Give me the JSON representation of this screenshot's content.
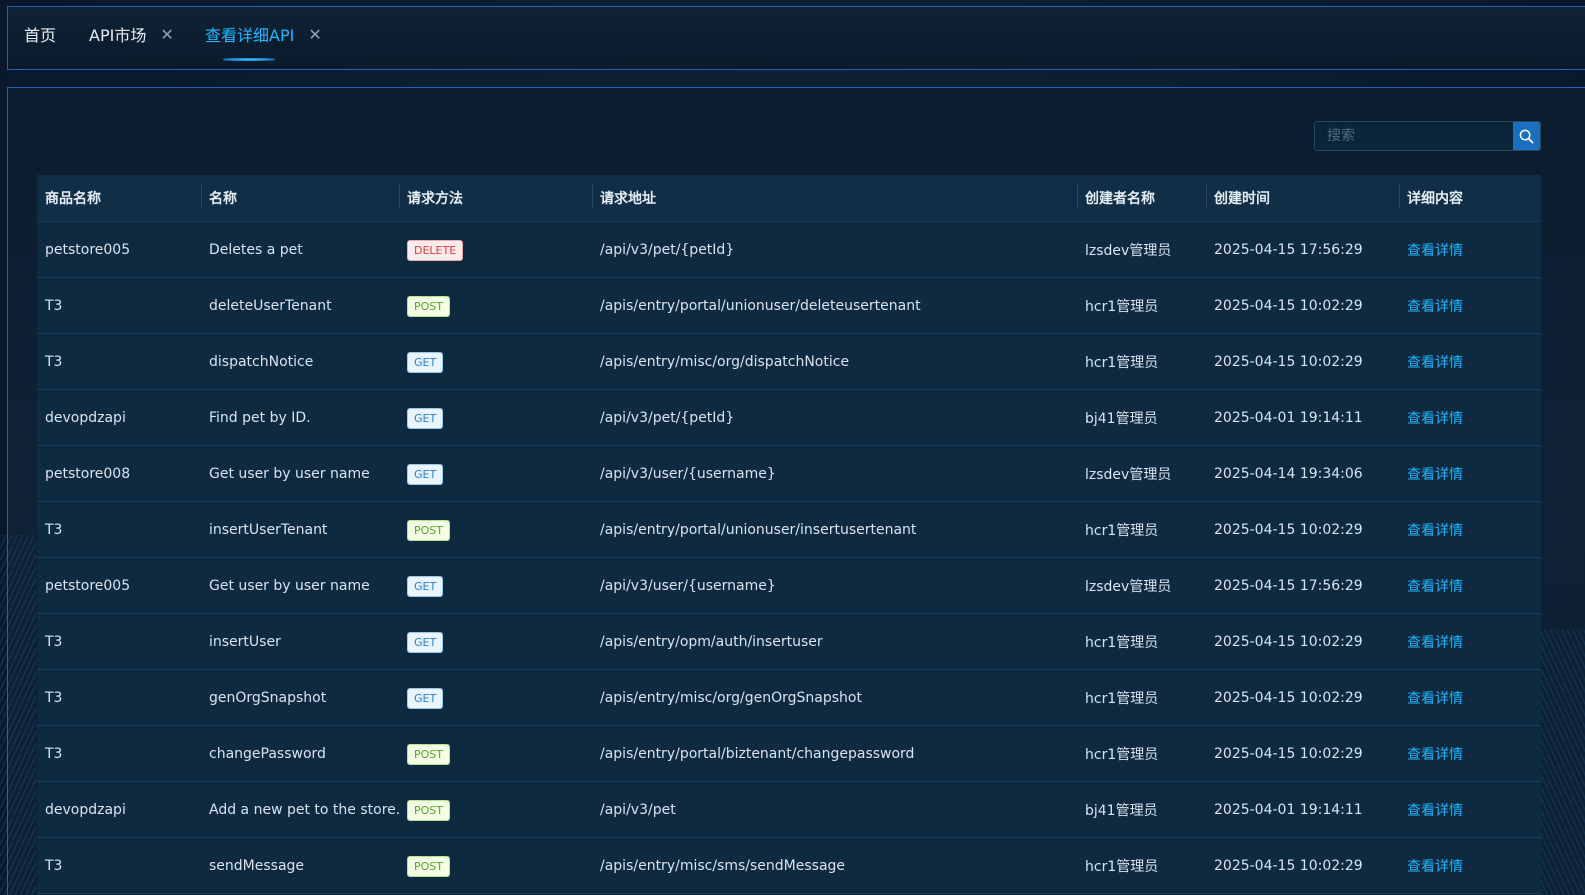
{
  "tabs": [
    {
      "label": "首页",
      "closable": false,
      "active": false
    },
    {
      "label": "API市场",
      "closable": true,
      "active": false
    },
    {
      "label": "查看详细API",
      "closable": true,
      "active": true
    }
  ],
  "search": {
    "placeholder": "搜索",
    "value": ""
  },
  "table": {
    "columns": [
      "商品名称",
      "名称",
      "请求方法",
      "请求地址",
      "创建者名称",
      "创建时间",
      "详细内容"
    ],
    "rows": [
      {
        "product": "petstore005",
        "name": "Deletes a pet",
        "method": "DELETE",
        "url": "/api/v3/pet/{petId}",
        "creator": "lzsdev管理员",
        "time": "2025-04-15 17:56:29",
        "detail": "查看详情"
      },
      {
        "product": "T3",
        "name": "deleteUserTenant",
        "method": "POST",
        "url": "/apis/entry/portal/unionuser/deleteusertenant",
        "creator": "hcr1管理员",
        "time": "2025-04-15 10:02:29",
        "detail": "查看详情"
      },
      {
        "product": "T3",
        "name": "dispatchNotice",
        "method": "GET",
        "url": "/apis/entry/misc/org/dispatchNotice",
        "creator": "hcr1管理员",
        "time": "2025-04-15 10:02:29",
        "detail": "查看详情"
      },
      {
        "product": "devopdzapi",
        "name": "Find pet by ID.",
        "method": "GET",
        "url": "/api/v3/pet/{petId}",
        "creator": "bj41管理员",
        "time": "2025-04-01 19:14:11",
        "detail": "查看详情"
      },
      {
        "product": "petstore008",
        "name": "Get user by user name",
        "method": "GET",
        "url": "/api/v3/user/{username}",
        "creator": "lzsdev管理员",
        "time": "2025-04-14 19:34:06",
        "detail": "查看详情"
      },
      {
        "product": "T3",
        "name": "insertUserTenant",
        "method": "POST",
        "url": "/apis/entry/portal/unionuser/insertusertenant",
        "creator": "hcr1管理员",
        "time": "2025-04-15 10:02:29",
        "detail": "查看详情"
      },
      {
        "product": "petstore005",
        "name": "Get user by user name",
        "method": "GET",
        "url": "/api/v3/user/{username}",
        "creator": "lzsdev管理员",
        "time": "2025-04-15 17:56:29",
        "detail": "查看详情"
      },
      {
        "product": "T3",
        "name": "insertUser",
        "method": "GET",
        "url": "/apis/entry/opm/auth/insertuser",
        "creator": "hcr1管理员",
        "time": "2025-04-15 10:02:29",
        "detail": "查看详情"
      },
      {
        "product": "T3",
        "name": "genOrgSnapshot",
        "method": "GET",
        "url": "/apis/entry/misc/org/genOrgSnapshot",
        "creator": "hcr1管理员",
        "time": "2025-04-15 10:02:29",
        "detail": "查看详情"
      },
      {
        "product": "T3",
        "name": "changePassword",
        "method": "POST",
        "url": "/apis/entry/portal/biztenant/changepassword",
        "creator": "hcr1管理员",
        "time": "2025-04-15 10:02:29",
        "detail": "查看详情"
      },
      {
        "product": "devopdzapi",
        "name": "Add a new pet to the store.",
        "method": "POST",
        "url": "/api/v3/pet",
        "creator": "bj41管理员",
        "time": "2025-04-01 19:14:11",
        "detail": "查看详情"
      },
      {
        "product": "T3",
        "name": "sendMessage",
        "method": "POST",
        "url": "/apis/entry/misc/sms/sendMessage",
        "creator": "hcr1管理员",
        "time": "2025-04-15 10:02:29",
        "detail": "查看详情"
      }
    ]
  }
}
